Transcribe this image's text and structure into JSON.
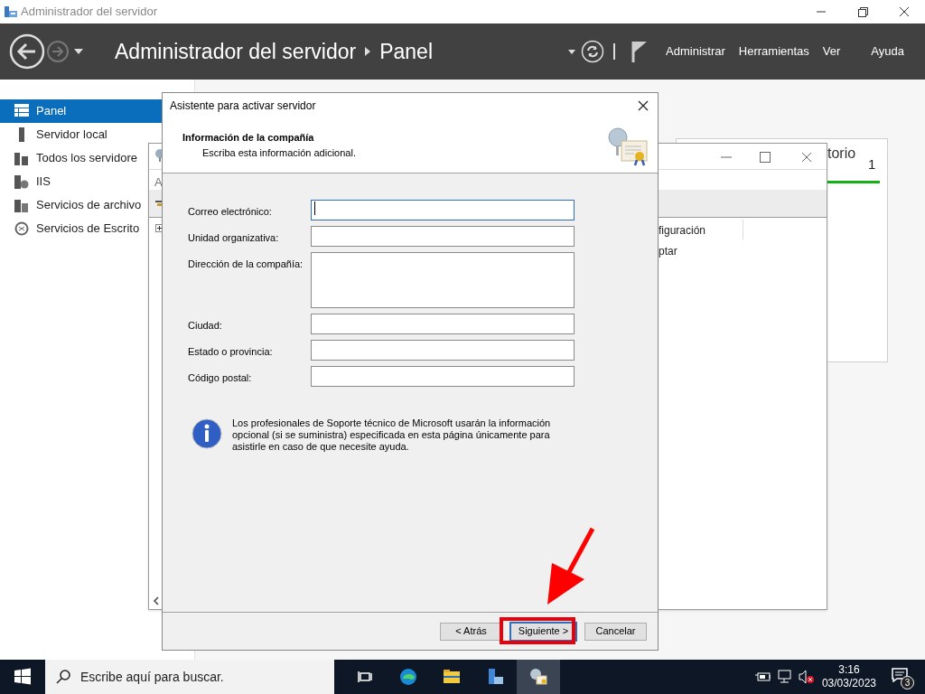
{
  "window": {
    "title": "Administrador del servidor"
  },
  "header": {
    "breadcrumb": [
      "Administrador del servidor",
      "Panel"
    ],
    "menu": [
      "Administrar",
      "Herramientas",
      "Ver",
      "Ayuda"
    ]
  },
  "sidebar": {
    "items": [
      {
        "label": "Panel",
        "selected": true
      },
      {
        "label": "Servidor local",
        "selected": false
      },
      {
        "label": "Todos los servidore",
        "selected": false
      },
      {
        "label": "IIS",
        "selected": false
      },
      {
        "label": "Servicios de archivo",
        "selected": false
      },
      {
        "label": "Servicios de Escrito",
        "selected": false
      }
    ]
  },
  "tile": {
    "title": "torio",
    "count": "1"
  },
  "background_window": {
    "toolbar_label": "A",
    "rows": [
      "figuración",
      "ptar"
    ]
  },
  "dialog": {
    "title": "Asistente para activar servidor",
    "heading": "Información de la compañía",
    "subtitle": "Escriba esta información adicional.",
    "fields": [
      {
        "label": "Correo electrónico:",
        "kind": "line",
        "focused": true
      },
      {
        "label": "Unidad organizativa:",
        "kind": "line",
        "focused": false
      },
      {
        "label": "Dirección de la compañía:",
        "kind": "multiline",
        "focused": false
      },
      {
        "label": "Ciudad:",
        "kind": "line",
        "focused": false
      },
      {
        "label": "Estado o provincia:",
        "kind": "line",
        "focused": false
      },
      {
        "label": "Código postal:",
        "kind": "line",
        "focused": false
      }
    ],
    "info": "Los profesionales de Soporte técnico de Microsoft usarán la información opcional (si se suministra) especificada en esta página únicamente para asistirle en caso de que necesite ayuda.",
    "buttons": [
      {
        "label": "< Atrás",
        "default": false
      },
      {
        "label": "Siguiente >",
        "default": true
      },
      {
        "label": "Cancelar",
        "default": false
      }
    ]
  },
  "taskbar": {
    "search_placeholder": "Escribe aquí para buscar.",
    "apps": [
      {
        "kind": "taskview",
        "active": false
      },
      {
        "kind": "browser",
        "active": false
      },
      {
        "kind": "folder",
        "active": false
      },
      {
        "kind": "server",
        "active": false
      },
      {
        "kind": "wizard",
        "active": true
      }
    ],
    "time": "3:16",
    "date": "03/03/2023",
    "notification_count": "3"
  }
}
